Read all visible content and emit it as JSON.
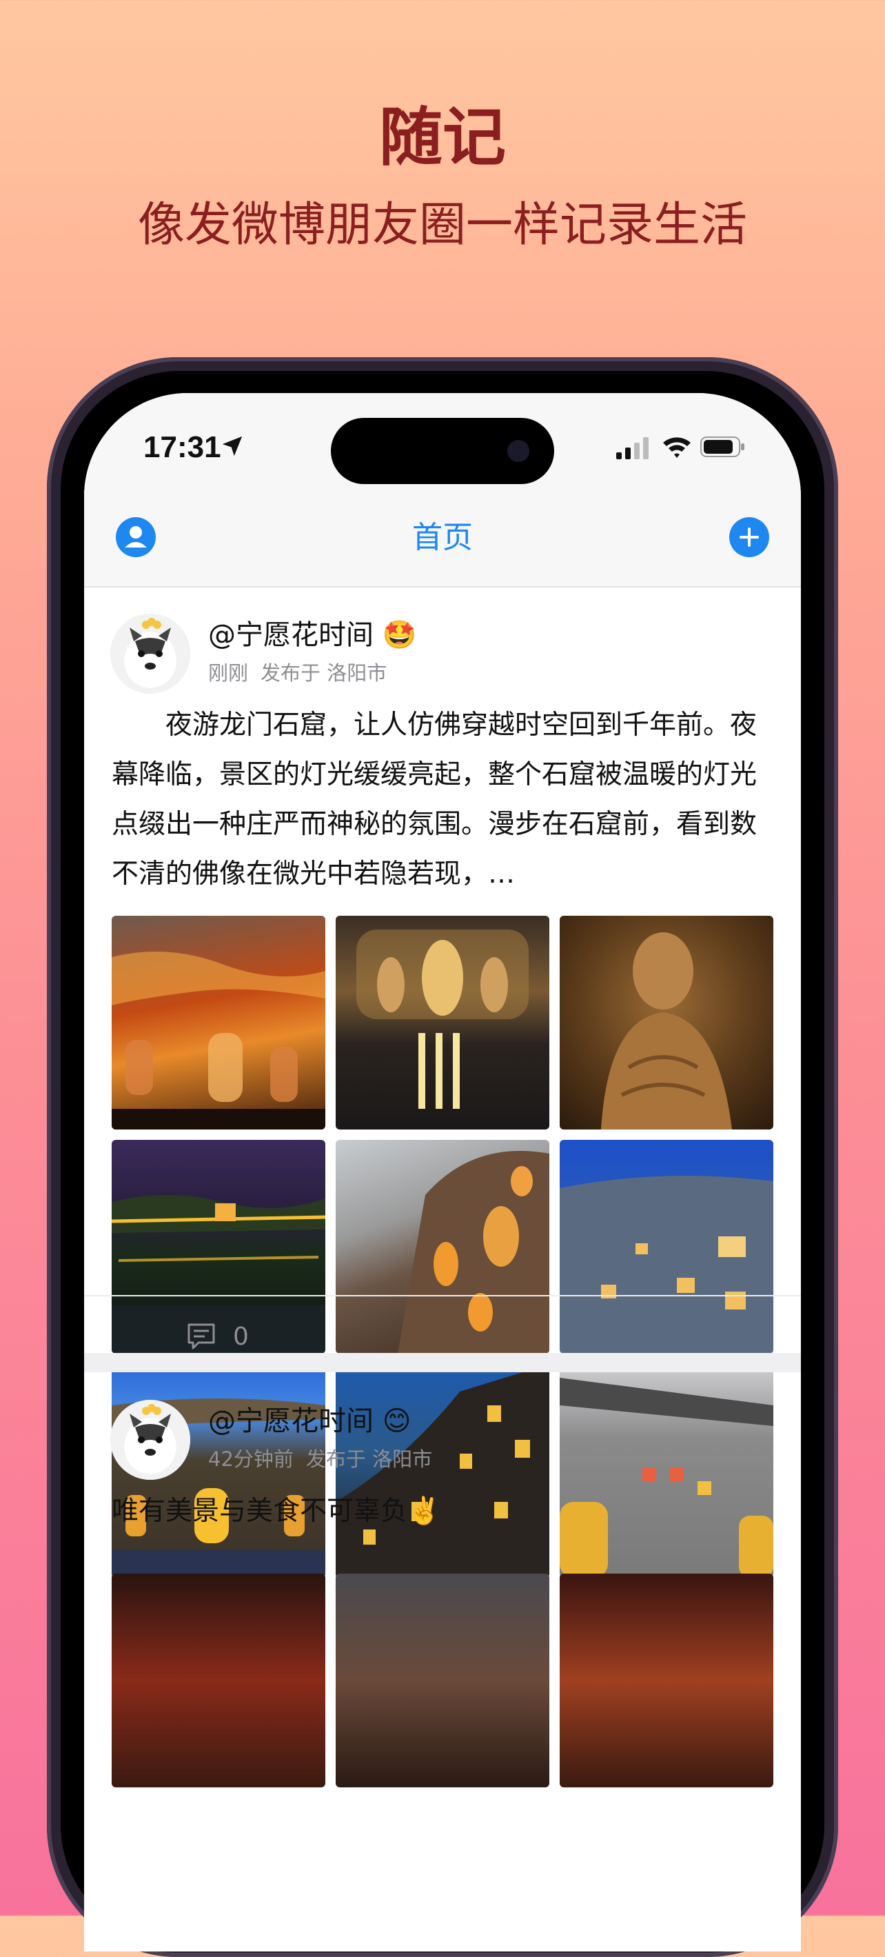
{
  "hero": {
    "title": "随记",
    "subtitle": "像发微博朋友圈一样记录生活"
  },
  "status_bar": {
    "time": "17:31"
  },
  "nav": {
    "title": "首页",
    "left_icon": "person-icon",
    "right_icon": "plus-icon"
  },
  "posts": [
    {
      "username": "@宁愿花时间",
      "emoji": "🤩",
      "time": "刚刚",
      "location": "发布于 洛阳市",
      "text": "　　夜游龙门石窟，让人仿佛穿越时空回到千年前。夜幕降临，景区的灯光缓缓亮起，整个石窟被温暖的灯光点缀出一种庄严而神秘的氛围。漫步在石窟前，看到数不清的佛像在微光中若隐若现，…",
      "comment_count": "0",
      "photos": [
        "cliff-grottoes-orange-lit",
        "grottoes-main-buddhas-night",
        "buddha-statue-closeup",
        "river-reflection-lights",
        "cliff-caves-dusk",
        "caves-blue-sky-night",
        "cliff-grottoes-blue-hour",
        "cave-niches-dark-sky",
        "cave-niches-overcast"
      ]
    },
    {
      "username": "@宁愿花时间",
      "emoji": "😊",
      "time": "42分钟前",
      "location": "发布于 洛阳市",
      "text": "唯有美景与美食不可辜负✌️"
    }
  ],
  "colors": {
    "accent": "#1E88F0",
    "hero_text": "#8B1E1E"
  }
}
